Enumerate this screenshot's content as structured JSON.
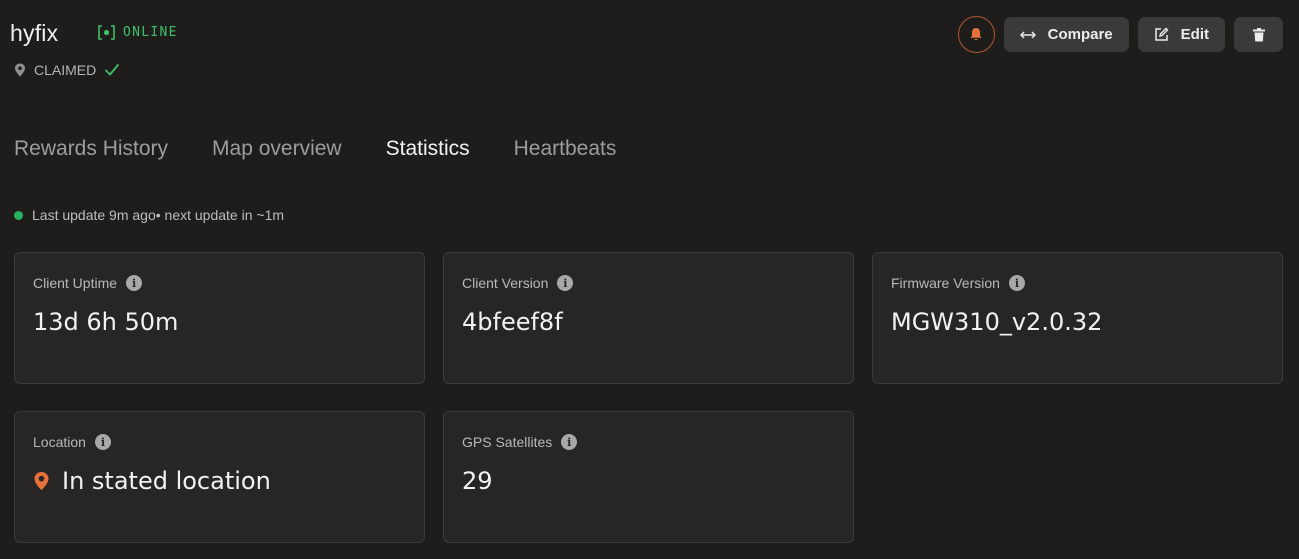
{
  "header": {
    "device_name": "hyfix",
    "status": "ONLINE",
    "claim_status": "CLAIMED",
    "colors": {
      "online": "#3fc06b",
      "bell": "#e8703a"
    }
  },
  "actions": {
    "compare_label": "Compare",
    "edit_label": "Edit"
  },
  "tabs": [
    {
      "label": "Rewards History",
      "active": false
    },
    {
      "label": "Map overview",
      "active": false
    },
    {
      "label": "Statistics",
      "active": true
    },
    {
      "label": "Heartbeats",
      "active": false
    }
  ],
  "update_text": "Last update 9m ago• next update in ~1m",
  "stats": [
    {
      "label": "Client Uptime",
      "value": "13d 6h 50m"
    },
    {
      "label": "Client Version",
      "value": "4bfeef8f"
    },
    {
      "label": "Firmware Version",
      "value": "MGW310_v2.0.32"
    },
    {
      "label": "Location",
      "value": "In stated location",
      "icon": "location-pin-icon"
    },
    {
      "label": "GPS Satellites",
      "value": "29"
    }
  ]
}
